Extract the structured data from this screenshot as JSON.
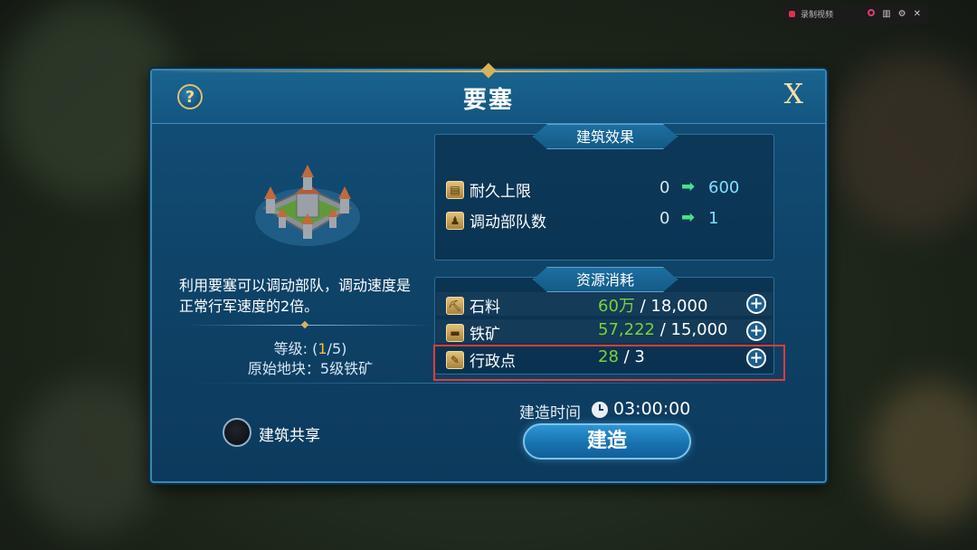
{
  "recorder": {
    "label": "录制视频"
  },
  "panel": {
    "title": "要塞",
    "help_glyph": "?",
    "close_glyph": "X"
  },
  "building": {
    "description": "利用要塞可以调动部队，调动速度是正常行军速度的2倍。",
    "level_label": "等级: (",
    "level_current": "1",
    "level_max": "/5)",
    "original_tile": "原始地块：5级铁矿"
  },
  "effects": {
    "header": "建筑效果",
    "rows": [
      {
        "label": "耐久上限",
        "from": "0",
        "arrow": "➡",
        "to": "600",
        "icon": "durability-icon"
      },
      {
        "label": "调动部队数",
        "from": "0",
        "arrow": "➡",
        "to": "1",
        "icon": "troop-icon"
      }
    ]
  },
  "resources": {
    "header": "资源消耗",
    "rows": [
      {
        "label": "石料",
        "have": "60万",
        "need": "/ 18,000",
        "icon": "stone-icon"
      },
      {
        "label": "铁矿",
        "have": "57,222",
        "need": "/ 15,000",
        "icon": "iron-icon"
      },
      {
        "label": "行政点",
        "have": "28",
        "need": "/ 3",
        "icon": "admin-point-icon"
      }
    ]
  },
  "footer": {
    "share_label": "建筑共享",
    "build_time_label": "建造时间",
    "build_time": "03:00:00",
    "build_button": "建造"
  },
  "colors": {
    "accent": "#7ad13f",
    "highlight": "#e03b3b",
    "panel": "#0f4469"
  }
}
